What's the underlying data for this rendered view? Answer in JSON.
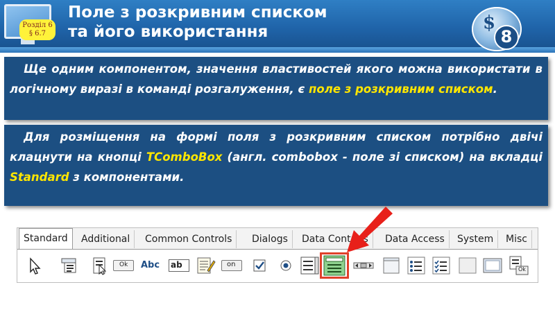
{
  "header": {
    "title_line1": "Поле з розкривним списком",
    "title_line2": "та його використання",
    "section_line1": "Розділ 6",
    "section_line2": "§ 6.7",
    "grade": "8",
    "colors": {
      "band": "#1f63a8",
      "badge": "#fff23a",
      "panel": "#1c4f82",
      "highlight_text": "#ffe600"
    }
  },
  "panel1": {
    "text_before": "Ще одним компонентом, значення властивостей якого можна використати в логічному виразі в команді розгалуження, є ",
    "highlight": "поле з розкривним списком",
    "text_after": "."
  },
  "panel2": {
    "part1": "Для розміщення на формі поля з розкривним списком потрібно двічі клацнути на кнопці ",
    "hl1": "TComboBox",
    "part2": " (англ. combobox - поле зі списком) на вкладці ",
    "hl2": "Standard",
    "part3": " з компонентами."
  },
  "palette": {
    "tabs": [
      "Standard",
      "Additional",
      "Common Controls",
      "Dialogs",
      "Data Controls",
      "Data Access",
      "System",
      "Misc"
    ],
    "active_tab": "Standard",
    "tools": [
      {
        "icon": "pointer-icon"
      },
      {
        "icon": "main-menu-icon"
      },
      {
        "icon": "popup-menu-icon"
      },
      {
        "icon": "button-icon",
        "label": "Ok"
      },
      {
        "icon": "label-icon",
        "label": "Abc"
      },
      {
        "icon": "edit-icon",
        "label": "ab"
      },
      {
        "icon": "memo-icon"
      },
      {
        "icon": "toggle-box-icon",
        "label": "on"
      },
      {
        "icon": "checkbox-icon"
      },
      {
        "icon": "radio-button-icon"
      },
      {
        "icon": "listbox-icon"
      },
      {
        "icon": "combobox-icon",
        "highlighted": true
      },
      {
        "icon": "scrollbar-icon"
      },
      {
        "icon": "groupbox-icon"
      },
      {
        "icon": "radio-group-icon"
      },
      {
        "icon": "check-group-icon"
      },
      {
        "icon": "panel-icon"
      },
      {
        "icon": "frame-icon"
      },
      {
        "icon": "action-list-icon",
        "label": "Ok"
      }
    ]
  }
}
